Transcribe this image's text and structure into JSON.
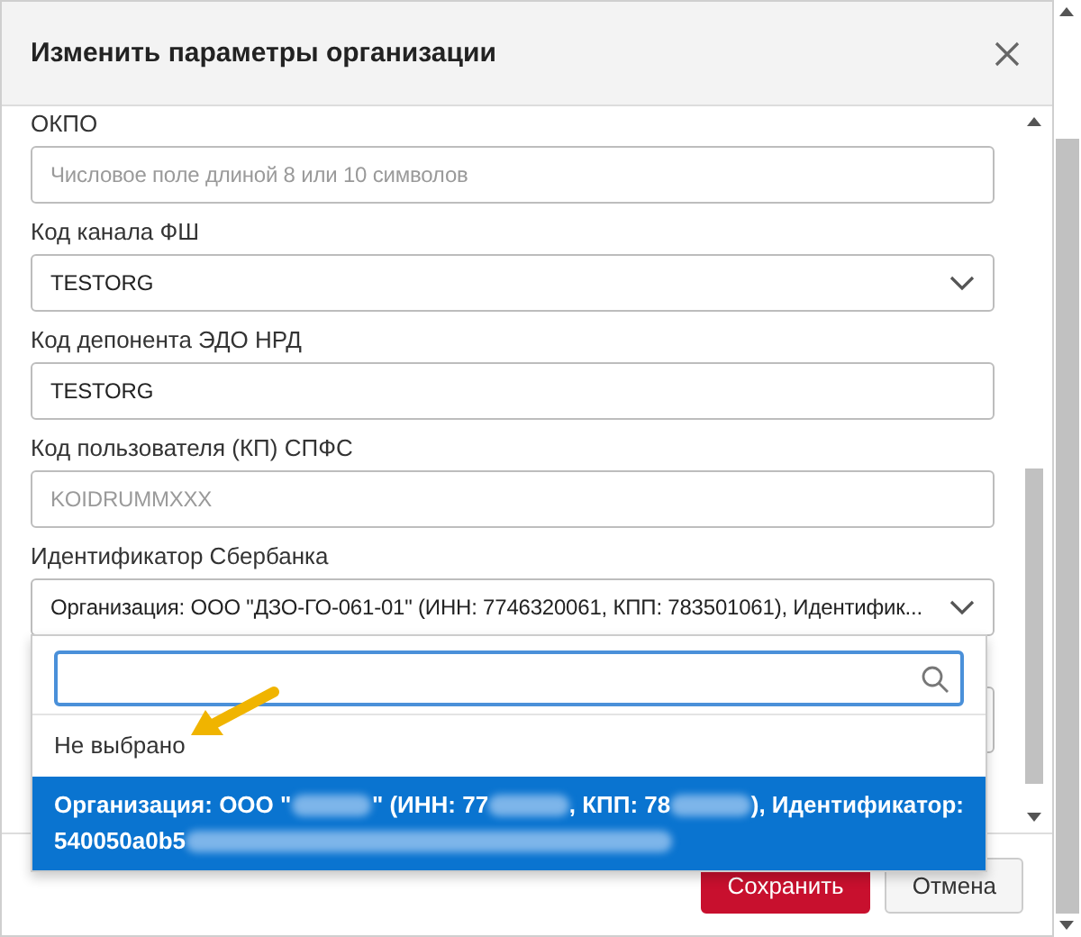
{
  "dialog": {
    "title": "Изменить параметры организации"
  },
  "fields": [
    {
      "kind": "input",
      "label": "ОКПО",
      "placeholder": "Числовое поле длиной 8 или 10 символов"
    },
    {
      "kind": "select",
      "label": "Код канала ФШ",
      "value": "TESTORG"
    },
    {
      "kind": "input",
      "label": "Код депонента ЭДО НРД",
      "value": "TESTORG"
    },
    {
      "kind": "input",
      "label": "Код пользователя (КП) СПФС",
      "placeholder": "KOIDRUMMXXX"
    },
    {
      "kind": "select",
      "label": "Идентификатор Сбербанка",
      "value": "Организация: ООО \"ДЗО-ГО-061-01\" (ИНН: 7746320061, КПП: 783501061), Идентифик..."
    }
  ],
  "dropdown": {
    "options": [
      {
        "selected": false,
        "lines": [
          [
            {
              "kind": "text",
              "text": "Не выбрано"
            }
          ]
        ]
      },
      {
        "selected": true,
        "lines": [
          [
            {
              "kind": "text",
              "text": "Организация: ООО \""
            },
            {
              "kind": "redacted"
            },
            {
              "kind": "text",
              "text": "\" (ИНН: 77"
            },
            {
              "kind": "redacted"
            },
            {
              "kind": "text",
              "text": ", КПП: 78"
            },
            {
              "kind": "redacted"
            },
            {
              "kind": "text",
              "text": "), Идентификатор:"
            }
          ],
          [
            {
              "kind": "text",
              "text": "540050a0b5"
            },
            {
              "kind": "redacted_long"
            }
          ]
        ]
      }
    ]
  },
  "buttons": [
    {
      "kind": "primary",
      "label": "Сохранить"
    },
    {
      "kind": "secondary",
      "label": "Отмена"
    }
  ]
}
